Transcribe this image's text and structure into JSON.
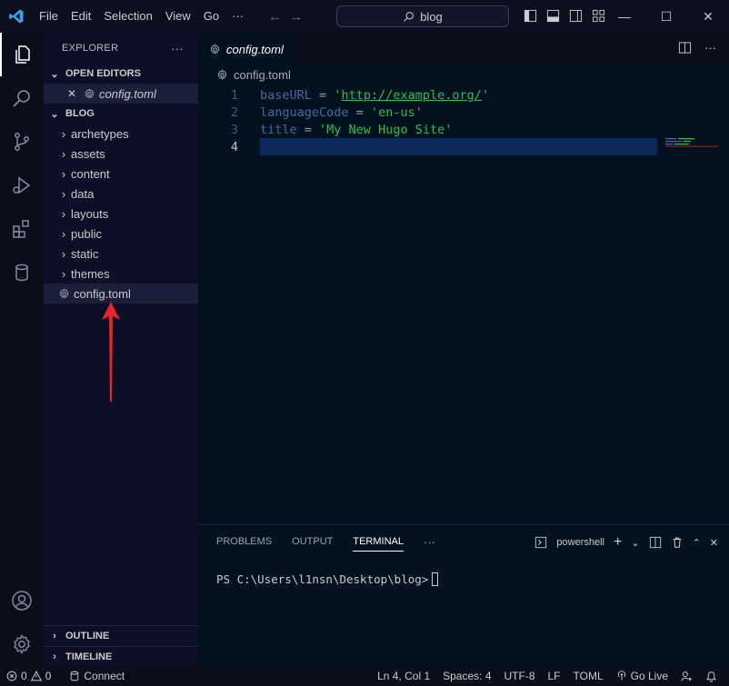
{
  "titlebar": {
    "menu": [
      "File",
      "Edit",
      "Selection",
      "View",
      "Go",
      "···"
    ],
    "search_text": "blog",
    "window_controls": [
      "minimize",
      "maximize",
      "close"
    ]
  },
  "sidebar": {
    "title": "EXPLORER",
    "more": "···",
    "open_editors": {
      "label": "OPEN EDITORS",
      "items": [
        {
          "close": "✕",
          "name": "config.toml"
        }
      ]
    },
    "folder": {
      "label": "BLOG",
      "items": [
        {
          "type": "folder",
          "name": "archetypes"
        },
        {
          "type": "folder",
          "name": "assets"
        },
        {
          "type": "folder",
          "name": "content"
        },
        {
          "type": "folder",
          "name": "data"
        },
        {
          "type": "folder",
          "name": "layouts"
        },
        {
          "type": "folder",
          "name": "public"
        },
        {
          "type": "folder",
          "name": "static"
        },
        {
          "type": "folder",
          "name": "themes"
        },
        {
          "type": "file",
          "name": "config.toml"
        }
      ]
    },
    "outline_label": "OUTLINE",
    "timeline_label": "TIMELINE"
  },
  "editor": {
    "tab_label": "config.toml",
    "breadcrumb": "config.toml",
    "lines": [
      {
        "num": "1",
        "key": "baseURL",
        "eq": " = ",
        "q1": "'",
        "val": "http://example.org/",
        "q2": "'"
      },
      {
        "num": "2",
        "key": "languageCode",
        "eq": " = ",
        "q1": "'",
        "val": "en-us",
        "q2": "'"
      },
      {
        "num": "3",
        "key": "title",
        "eq": " = ",
        "q1": "'",
        "val": "My New Hugo Site",
        "q2": "'"
      },
      {
        "num": "4",
        "key": "",
        "eq": "",
        "q1": "",
        "val": "",
        "q2": ""
      }
    ]
  },
  "panel": {
    "tabs": [
      "PROBLEMS",
      "OUTPUT",
      "TERMINAL",
      "···"
    ],
    "active_tab": "TERMINAL",
    "shell_label": "powershell",
    "prompt": "PS C:\\Users\\l1nsn\\Desktop\\blog>"
  },
  "status": {
    "errors": "0",
    "warnings": "0",
    "connect": "Connect",
    "position": "Ln 4, Col 1",
    "spaces": "Spaces: 4",
    "encoding": "UTF-8",
    "eol": "LF",
    "language": "TOML",
    "golive": "Go Live"
  },
  "colors": {
    "accent": "#0a2a5a",
    "string": "#2fbf4f",
    "key": "#3b6ea5",
    "annotation_arrow": "#e8242a"
  }
}
